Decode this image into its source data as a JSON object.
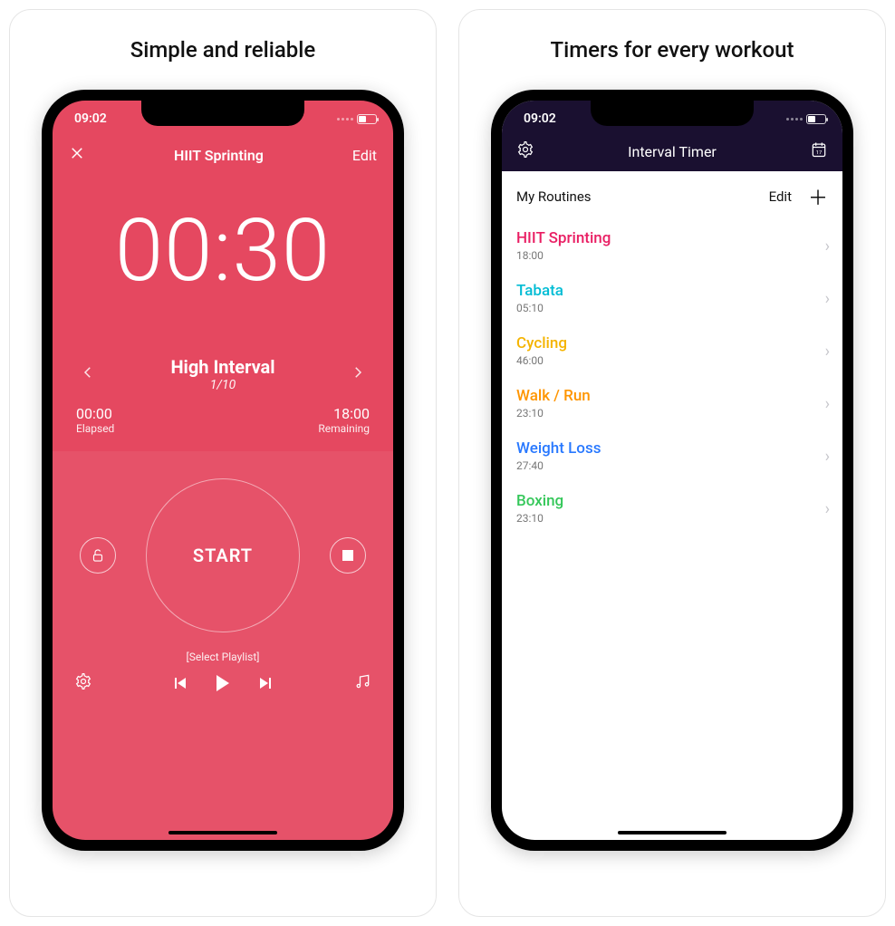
{
  "captions": {
    "left": "Simple and reliable",
    "right": "Timers for every workout"
  },
  "status": {
    "time": "09:02"
  },
  "timer": {
    "nav_title": "HIIT Sprinting",
    "edit_label": "Edit",
    "big_time": "00:30",
    "interval_name": "High Interval",
    "interval_count": "1/10",
    "elapsed_time": "00:00",
    "elapsed_label": "Elapsed",
    "remaining_time": "18:00",
    "remaining_label": "Remaining",
    "start_label": "START",
    "playlist_label": "[Select Playlist]"
  },
  "list": {
    "nav_title": "Interval Timer",
    "section_header": "My Routines",
    "edit_label": "Edit",
    "routines": [
      {
        "name": "HIIT Sprinting",
        "duration": "18:00",
        "color": "#e91e63"
      },
      {
        "name": "Tabata",
        "duration": "05:10",
        "color": "#00bcd4"
      },
      {
        "name": "Cycling",
        "duration": "46:00",
        "color": "#f5b400"
      },
      {
        "name": "Walk / Run",
        "duration": "23:10",
        "color": "#ff9500"
      },
      {
        "name": "Weight Loss",
        "duration": "27:40",
        "color": "#2979ff"
      },
      {
        "name": "Boxing",
        "duration": "23:10",
        "color": "#34c759"
      }
    ]
  }
}
